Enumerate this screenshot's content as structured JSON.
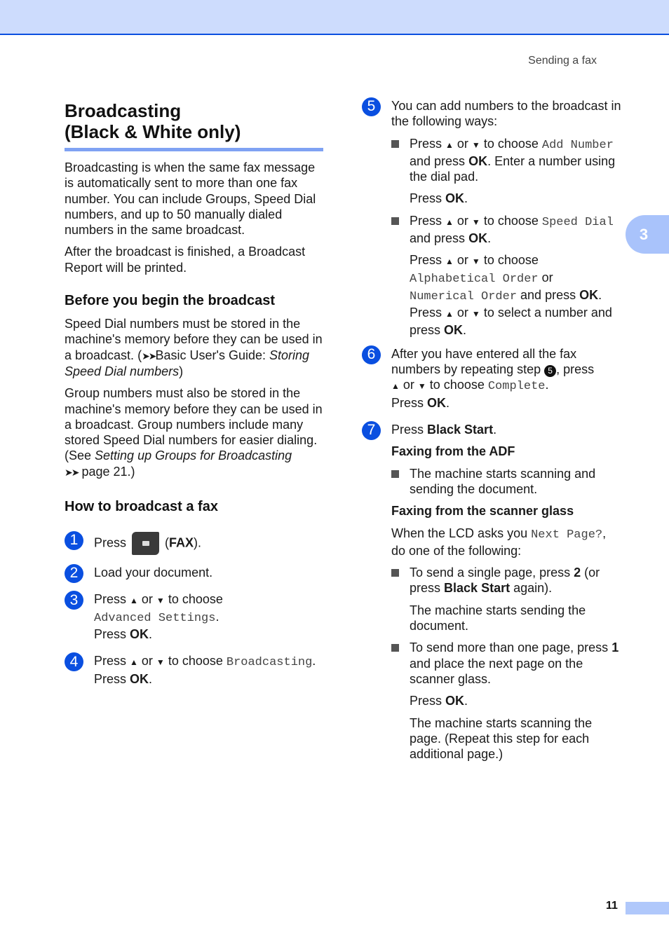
{
  "header": {
    "running_head": "Sending a fax",
    "chapter_tab": "3"
  },
  "footer": {
    "page_number": "11"
  },
  "left": {
    "title_line1": "Broadcasting",
    "title_line2": "(Black & White only)",
    "intro_p1": "Broadcasting is when the same fax message is automatically sent to more than one fax number. You can include Groups, Speed Dial numbers, and up to 50 manually dialed numbers in the same broadcast.",
    "intro_p2": "After the broadcast is finished, a Broadcast Report will be printed.",
    "before_heading": "Before you begin the broadcast",
    "before_p1_a": "Speed Dial numbers must be stored in the machine's memory before they can be used in a broadcast. (",
    "before_p1_arrows": "➤➤",
    "before_p1_b": "Basic User's Guide: ",
    "before_p1_italic": "Storing Speed Dial numbers",
    "before_p1_c": ")",
    "before_p2_a": "Group numbers must also be stored in the machine's memory before they can be used in a broadcast. Group numbers include many stored Speed Dial numbers for easier dialing. (See ",
    "before_p2_italic": "Setting up Groups for Broadcasting",
    "before_p2_arrows": "➤➤",
    "before_p2_b": " page 21.)",
    "how_heading": "How to broadcast a fax",
    "steps": [
      {
        "num": "1",
        "press": "Press",
        "paren_open": " (",
        "key": "FAX",
        "paren_close": ")."
      },
      {
        "num": "2",
        "text": "Load your document."
      },
      {
        "num": "3",
        "a": "Press ",
        "up": "▲",
        "or": " or ",
        "down": "▼",
        "b": " to choose",
        "mono": "Advanced Settings",
        "dot": ".",
        "press": "Press ",
        "ok": "OK",
        "end": "."
      },
      {
        "num": "4",
        "a": "Press ",
        "up": "▲",
        "or": " or ",
        "down": "▼",
        "b": " to choose ",
        "mono": "Broadcasting",
        "dot": ".",
        "press": "Press ",
        "ok": "OK",
        "end": "."
      }
    ]
  },
  "right": {
    "step5": {
      "num": "5",
      "text": "You can add numbers to the broadcast in the following ways:",
      "bullet1_a": "Press ",
      "bullet1_b": " to choose ",
      "bullet1_mono": "Add Number",
      "bullet1_c": "and press ",
      "bullet1_ok": "OK",
      "bullet1_d": ". Enter a number using the dial pad.",
      "bullet1_press": "Press ",
      "bullet1_ok2": "OK",
      "bullet1_end": ".",
      "bullet2_a": "Press ",
      "bullet2_b": " to choose ",
      "bullet2_mono": "Speed Dial",
      "bullet2_c": "and press ",
      "bullet2_ok": "OK",
      "bullet2_end": ".",
      "sub_a": "Press ",
      "sub_b": " to choose",
      "sub_mono1": "Alphabetical Order",
      "sub_or": " or",
      "sub_mono2": "Numerical Order",
      "sub_c": " and press ",
      "sub_ok": "OK",
      "sub_d": ".",
      "sub_e": "Press ",
      "sub_f": " to select a number and press ",
      "sub_ok2": "OK",
      "sub_end": "."
    },
    "step6": {
      "num": "6",
      "a": "After you have entered all the fax numbers by repeating step ",
      "ref": "5",
      "b": ", press",
      "c": " to choose ",
      "mono": "Complete",
      "dot": ".",
      "press": "Press ",
      "ok": "OK",
      "end": "."
    },
    "step7": {
      "num": "7",
      "press": "Press ",
      "key": "Black Start",
      "end": ".",
      "adf_heading": "Faxing from the ADF",
      "adf_bullet": "The machine starts scanning and sending the document.",
      "glass_heading": "Faxing from the scanner glass",
      "glass_a": "When the LCD asks you ",
      "glass_mono": "Next Page?",
      "glass_b": ", do one of the following:",
      "single_a": "To send a single page, press ",
      "single_key": "2",
      "single_b": " (or press ",
      "single_key2": "Black Start",
      "single_c": " again).",
      "single_note": "The machine starts sending the document.",
      "multi_a": "To send more than one page, press ",
      "multi_key": "1",
      "multi_b": " and place the next page on the scanner glass.",
      "multi_press": "Press ",
      "multi_ok": "OK",
      "multi_end": ".",
      "multi_note": "The machine starts scanning the page. (Repeat this step for each additional page.)"
    },
    "symbols": {
      "up": "▲",
      "down": "▼",
      "or": " or "
    }
  },
  "colors": {
    "accent_blue": "#0a4fe0",
    "band": "#cddcfd",
    "tab": "#a9c3fb",
    "rule": "#7fa2f3"
  }
}
